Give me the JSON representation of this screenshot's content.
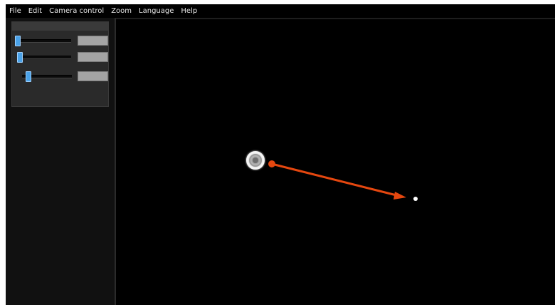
{
  "menubar": {
    "items": [
      {
        "label": "File"
      },
      {
        "label": "Edit"
      },
      {
        "label": "Camera control"
      },
      {
        "label": "Zoom"
      },
      {
        "label": "Language"
      },
      {
        "label": "Help"
      }
    ]
  },
  "controls": {
    "sliders": [
      {
        "value_text": "",
        "level": 0.0
      },
      {
        "value_text": "",
        "level": 0.03
      },
      {
        "value_text": "",
        "level": 0.22
      }
    ]
  },
  "viewport": {
    "bead_icon": "particle-bead",
    "arrow_color": "#e5470f",
    "point_icon": "target-dot"
  },
  "colors": {
    "slider_thumb": "#4aa2e8",
    "background": "#000000"
  }
}
